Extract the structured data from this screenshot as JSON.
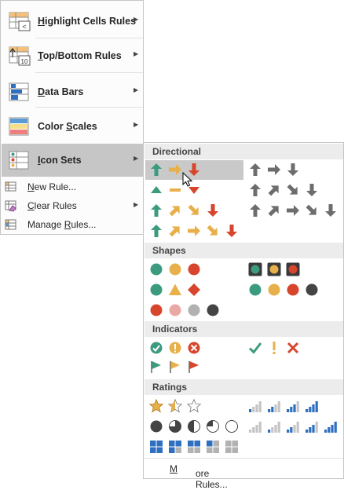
{
  "menu": {
    "items": [
      {
        "label_pre": "",
        "hotkey": "H",
        "label_post": "ighlight Cells Rules",
        "icon": "highlight-cells-rules-icon",
        "submenu": true
      },
      {
        "label_pre": "",
        "hotkey": "T",
        "label_post": "op/Bottom Rules",
        "icon": "top-bottom-rules-icon",
        "submenu": true
      },
      {
        "label_pre": "",
        "hotkey": "D",
        "label_post": "ata Bars",
        "icon": "data-bars-icon",
        "submenu": true
      },
      {
        "label_pre": "Color ",
        "hotkey": "S",
        "label_post": "cales",
        "icon": "color-scales-icon",
        "submenu": true
      },
      {
        "label_pre": "",
        "hotkey": "I",
        "label_post": "con Sets",
        "icon": "icon-sets-icon",
        "submenu": true,
        "highlighted": true
      }
    ],
    "commands": [
      {
        "label_pre": "",
        "hotkey": "N",
        "label_post": "ew Rule...",
        "icon": "new-rule-icon"
      },
      {
        "label_pre": "",
        "hotkey": "C",
        "label_post": "lear Rules",
        "icon": "clear-rules-icon",
        "submenu": true
      },
      {
        "label_pre": "Manage ",
        "hotkey": "R",
        "label_post": "ules...",
        "icon": "manage-rules-icon"
      }
    ],
    "thumb_text": {
      "highlight": "<",
      "topbottom": "10"
    }
  },
  "gallery": {
    "sections": [
      "Directional",
      "Shapes",
      "Indicators",
      "Ratings"
    ],
    "more_rules_pre": "",
    "more_rules_hotkey": "M",
    "more_rules_post": "ore Rules..."
  },
  "colors": {
    "green": "#3c9b7e",
    "yellow": "#e8b04a",
    "red": "#d7452c",
    "gray": "#6d6d6d",
    "black": "#444444",
    "pink": "#eaa8a4",
    "silver": "#b2b2b2",
    "blue": "#2e6fc0",
    "selection": "#c9c9c9",
    "header": "#ececec"
  }
}
